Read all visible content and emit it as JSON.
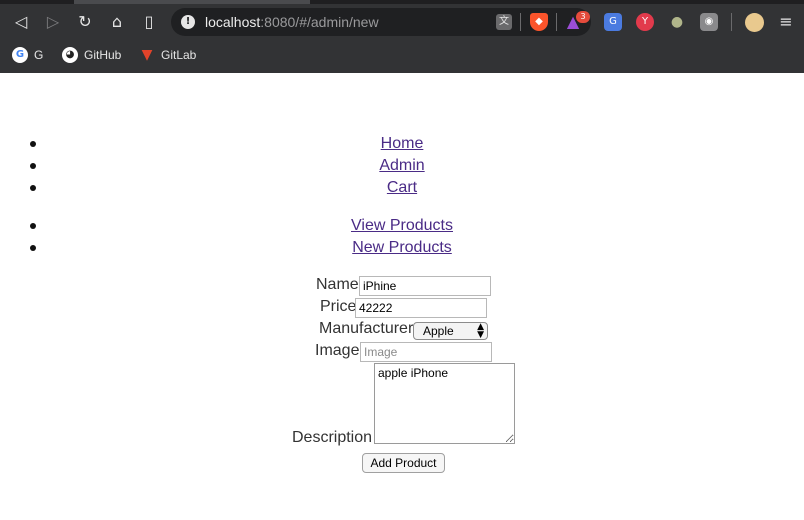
{
  "browser": {
    "url_host": "localhost",
    "url_path": ":8080/#/admin/new",
    "back_icon": "back-icon",
    "forward_icon": "forward-icon",
    "reload_icon": "reload-icon",
    "home_icon": "home-icon",
    "bookmark_icon": "bookmark-icon",
    "info_icon": "info-icon",
    "rewards_badge": "3",
    "bookmarks": [
      {
        "label": "G",
        "icon": "google-icon",
        "color": "#ffffff"
      },
      {
        "label": "GitHub",
        "icon": "github-icon",
        "color": "#ffffff"
      },
      {
        "label": "GitLab",
        "icon": "gitlab-icon",
        "color": "#e2432a"
      }
    ]
  },
  "nav": {
    "main": [
      "Home",
      "Admin",
      "Cart"
    ],
    "admin": [
      "View Products",
      "New Products"
    ]
  },
  "form": {
    "name_label": "Name",
    "name_value": "iPhine",
    "price_label": "Price",
    "price_value": "42222",
    "manufacturer_label": "Manufacturer",
    "manufacturer_selected": "Apple",
    "image_label": "Image",
    "image_placeholder": "Image",
    "description_label": "Description",
    "description_value": "apple iPhone",
    "submit_label": "Add Product"
  },
  "colors": {
    "link": "#4a2b86",
    "chrome_bg": "#323335",
    "brave_accent": "#fb542b"
  }
}
